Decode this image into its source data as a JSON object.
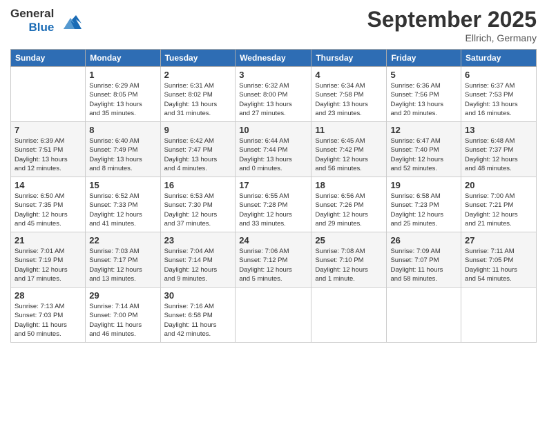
{
  "header": {
    "logo": {
      "general": "General",
      "blue": "Blue"
    },
    "month": "September 2025",
    "location": "Ellrich, Germany"
  },
  "weekdays": [
    "Sunday",
    "Monday",
    "Tuesday",
    "Wednesday",
    "Thursday",
    "Friday",
    "Saturday"
  ],
  "weeks": [
    [
      {
        "day": "",
        "info": ""
      },
      {
        "day": "1",
        "info": "Sunrise: 6:29 AM\nSunset: 8:05 PM\nDaylight: 13 hours\nand 35 minutes."
      },
      {
        "day": "2",
        "info": "Sunrise: 6:31 AM\nSunset: 8:02 PM\nDaylight: 13 hours\nand 31 minutes."
      },
      {
        "day": "3",
        "info": "Sunrise: 6:32 AM\nSunset: 8:00 PM\nDaylight: 13 hours\nand 27 minutes."
      },
      {
        "day": "4",
        "info": "Sunrise: 6:34 AM\nSunset: 7:58 PM\nDaylight: 13 hours\nand 23 minutes."
      },
      {
        "day": "5",
        "info": "Sunrise: 6:36 AM\nSunset: 7:56 PM\nDaylight: 13 hours\nand 20 minutes."
      },
      {
        "day": "6",
        "info": "Sunrise: 6:37 AM\nSunset: 7:53 PM\nDaylight: 13 hours\nand 16 minutes."
      }
    ],
    [
      {
        "day": "7",
        "info": "Sunrise: 6:39 AM\nSunset: 7:51 PM\nDaylight: 13 hours\nand 12 minutes."
      },
      {
        "day": "8",
        "info": "Sunrise: 6:40 AM\nSunset: 7:49 PM\nDaylight: 13 hours\nand 8 minutes."
      },
      {
        "day": "9",
        "info": "Sunrise: 6:42 AM\nSunset: 7:47 PM\nDaylight: 13 hours\nand 4 minutes."
      },
      {
        "day": "10",
        "info": "Sunrise: 6:44 AM\nSunset: 7:44 PM\nDaylight: 13 hours\nand 0 minutes."
      },
      {
        "day": "11",
        "info": "Sunrise: 6:45 AM\nSunset: 7:42 PM\nDaylight: 12 hours\nand 56 minutes."
      },
      {
        "day": "12",
        "info": "Sunrise: 6:47 AM\nSunset: 7:40 PM\nDaylight: 12 hours\nand 52 minutes."
      },
      {
        "day": "13",
        "info": "Sunrise: 6:48 AM\nSunset: 7:37 PM\nDaylight: 12 hours\nand 48 minutes."
      }
    ],
    [
      {
        "day": "14",
        "info": "Sunrise: 6:50 AM\nSunset: 7:35 PM\nDaylight: 12 hours\nand 45 minutes."
      },
      {
        "day": "15",
        "info": "Sunrise: 6:52 AM\nSunset: 7:33 PM\nDaylight: 12 hours\nand 41 minutes."
      },
      {
        "day": "16",
        "info": "Sunrise: 6:53 AM\nSunset: 7:30 PM\nDaylight: 12 hours\nand 37 minutes."
      },
      {
        "day": "17",
        "info": "Sunrise: 6:55 AM\nSunset: 7:28 PM\nDaylight: 12 hours\nand 33 minutes."
      },
      {
        "day": "18",
        "info": "Sunrise: 6:56 AM\nSunset: 7:26 PM\nDaylight: 12 hours\nand 29 minutes."
      },
      {
        "day": "19",
        "info": "Sunrise: 6:58 AM\nSunset: 7:23 PM\nDaylight: 12 hours\nand 25 minutes."
      },
      {
        "day": "20",
        "info": "Sunrise: 7:00 AM\nSunset: 7:21 PM\nDaylight: 12 hours\nand 21 minutes."
      }
    ],
    [
      {
        "day": "21",
        "info": "Sunrise: 7:01 AM\nSunset: 7:19 PM\nDaylight: 12 hours\nand 17 minutes."
      },
      {
        "day": "22",
        "info": "Sunrise: 7:03 AM\nSunset: 7:17 PM\nDaylight: 12 hours\nand 13 minutes."
      },
      {
        "day": "23",
        "info": "Sunrise: 7:04 AM\nSunset: 7:14 PM\nDaylight: 12 hours\nand 9 minutes."
      },
      {
        "day": "24",
        "info": "Sunrise: 7:06 AM\nSunset: 7:12 PM\nDaylight: 12 hours\nand 5 minutes."
      },
      {
        "day": "25",
        "info": "Sunrise: 7:08 AM\nSunset: 7:10 PM\nDaylight: 12 hours\nand 1 minute."
      },
      {
        "day": "26",
        "info": "Sunrise: 7:09 AM\nSunset: 7:07 PM\nDaylight: 11 hours\nand 58 minutes."
      },
      {
        "day": "27",
        "info": "Sunrise: 7:11 AM\nSunset: 7:05 PM\nDaylight: 11 hours\nand 54 minutes."
      }
    ],
    [
      {
        "day": "28",
        "info": "Sunrise: 7:13 AM\nSunset: 7:03 PM\nDaylight: 11 hours\nand 50 minutes."
      },
      {
        "day": "29",
        "info": "Sunrise: 7:14 AM\nSunset: 7:00 PM\nDaylight: 11 hours\nand 46 minutes."
      },
      {
        "day": "30",
        "info": "Sunrise: 7:16 AM\nSunset: 6:58 PM\nDaylight: 11 hours\nand 42 minutes."
      },
      {
        "day": "",
        "info": ""
      },
      {
        "day": "",
        "info": ""
      },
      {
        "day": "",
        "info": ""
      },
      {
        "day": "",
        "info": ""
      }
    ]
  ]
}
